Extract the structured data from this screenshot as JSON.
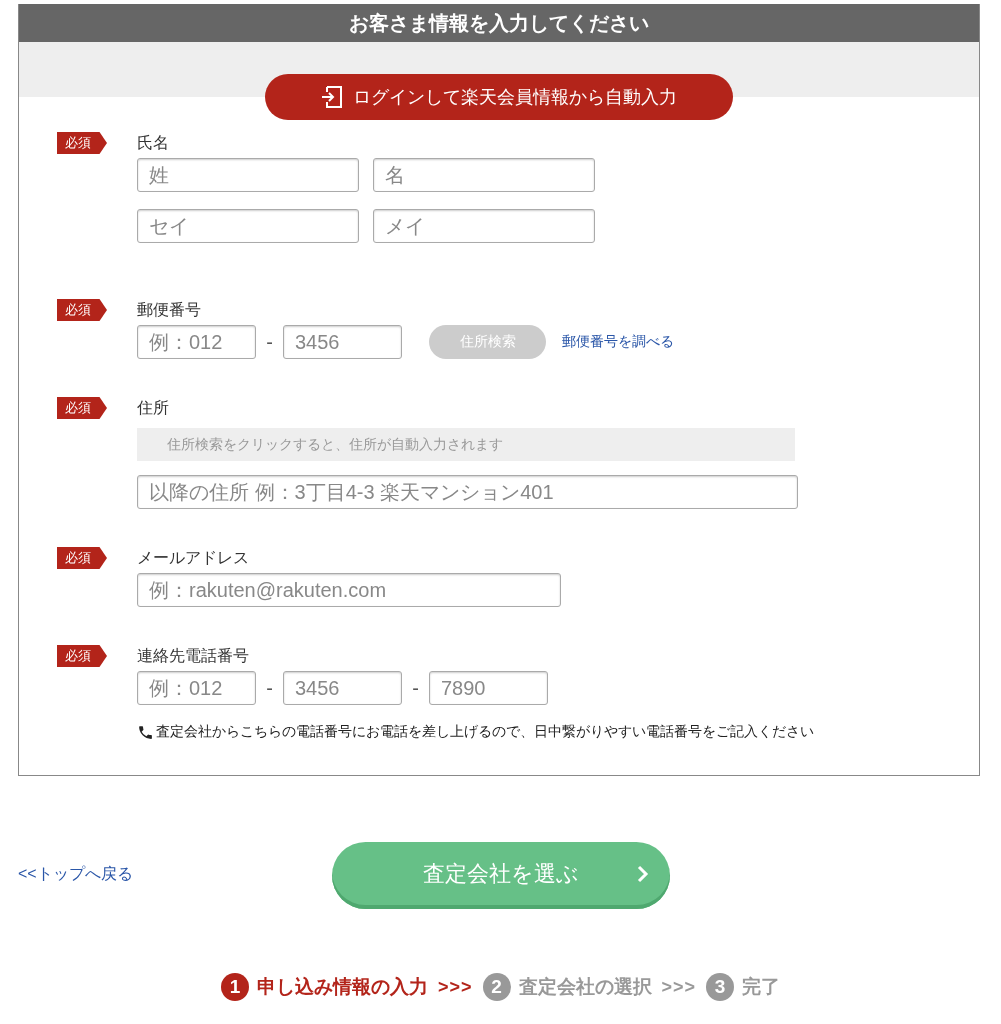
{
  "form": {
    "title": "お客さま情報を入力してください",
    "login_button": {
      "label": "ログインして楽天会員情報から自動入力"
    },
    "fields": [
      {
        "kind": "name",
        "badge": "必須",
        "label": "氏名",
        "inputs": [
          {
            "placeholder": "姓"
          },
          {
            "placeholder": "名"
          },
          {
            "placeholder": "セイ"
          },
          {
            "placeholder": "メイ"
          }
        ]
      },
      {
        "kind": "postal",
        "badge": "必須",
        "label": "郵便番号",
        "inputs": [
          {
            "placeholder": "例：012"
          },
          {
            "placeholder": "3456"
          }
        ],
        "separators": [
          "-"
        ],
        "search_button": {
          "label": "住所検索",
          "disabled": true
        },
        "link": "郵便番号を調べる"
      },
      {
        "kind": "address",
        "badge": "必須",
        "label": "住所",
        "note": "住所検索をクリックすると、住所が自動入力されます",
        "inputs": [
          {
            "placeholder": "以降の住所 例：3丁目4-3 楽天マンション401"
          }
        ]
      },
      {
        "kind": "email",
        "badge": "必須",
        "label": "メールアドレス",
        "inputs": [
          {
            "placeholder": "例：rakuten@rakuten.com"
          }
        ]
      },
      {
        "kind": "phone",
        "badge": "必須",
        "label": "連絡先電話番号",
        "inputs": [
          {
            "placeholder": "例：012"
          },
          {
            "placeholder": "3456"
          },
          {
            "placeholder": "7890"
          }
        ],
        "separators": [
          "-",
          "-"
        ],
        "hint": "査定会社からこちらの電話番号にお電話を差し上げるので、日中繋がりやすい電話番号をご記入ください"
      }
    ]
  },
  "back_link": "<<トップへ戻る",
  "submit_button": {
    "label": "査定会社を選ぶ"
  },
  "steps": [
    {
      "number": "1",
      "label": "申し込み情報の入力",
      "selected": true
    },
    {
      "number": "2",
      "label": "査定会社の選択",
      "selected": false
    },
    {
      "number": "3",
      "label": "完了",
      "selected": false
    }
  ],
  "step_separators": [
    ">>>",
    ">>>"
  ]
}
